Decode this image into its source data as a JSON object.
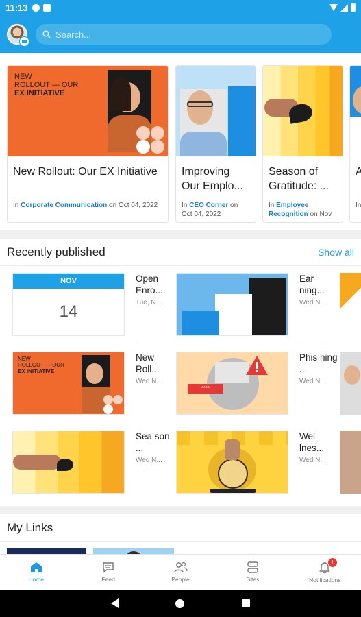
{
  "status_bar": {
    "time": "11:13"
  },
  "search": {
    "placeholder": "Search..."
  },
  "featured": [
    {
      "title": "New Rollout: Our EX Initiative",
      "in_label": "In",
      "category": "Corporate Communication",
      "date_text": "on Oct 04, 2022",
      "image_text": {
        "line1": "NEW",
        "line2": "ROLLOUT — OUR",
        "line3": "EX INITIATIVE"
      }
    },
    {
      "title": "Improving Our Emplo...",
      "in_label": "In",
      "category": "CEO Corner",
      "date_text": "on Oct 04, 2022"
    },
    {
      "title": "Season of Gratitude: ...",
      "in_label": "In",
      "category": "Employee Recognition",
      "date_text": "on Nov"
    },
    {
      "title": "A M",
      "in_label": "In",
      "category": "R",
      "date_text": ""
    }
  ],
  "recent": {
    "title": "Recently published",
    "show_all": "Show all",
    "items": [
      {
        "title": "Open Enro...",
        "date": "Tue, N...",
        "thumb": "calendar",
        "cal_month": "NOV",
        "cal_day": "14"
      },
      {
        "title": "Ear ning...",
        "date": "Wed N...",
        "thumb": "blocks"
      },
      {
        "title": "New Roll...",
        "date": "Wed N...",
        "thumb": "rollout",
        "image_text": {
          "line1": "NEW",
          "line2": "ROLLOUT — OUR",
          "line3": "EX INITIATIVE"
        }
      },
      {
        "title": "Phis hing ...",
        "date": "Wed N...",
        "thumb": "phishing"
      },
      {
        "title": "Sea son ...",
        "date": "Wed N...",
        "thumb": "gratitude"
      },
      {
        "title": "Wel lnes...",
        "date": "Wed N...",
        "thumb": "wellness"
      }
    ]
  },
  "my_links": {
    "title": "My Links"
  },
  "bottom_nav": [
    {
      "label": "Home",
      "icon": "home-icon",
      "active": true
    },
    {
      "label": "Feed",
      "icon": "feed-icon"
    },
    {
      "label": "People",
      "icon": "people-icon"
    },
    {
      "label": "Sites",
      "icon": "sites-icon"
    },
    {
      "label": "Notifications",
      "icon": "bell-icon",
      "badge": "1"
    }
  ],
  "colors": {
    "accent": "#1ea1e6",
    "link": "#1a7ec8",
    "badge": "#e53935"
  }
}
